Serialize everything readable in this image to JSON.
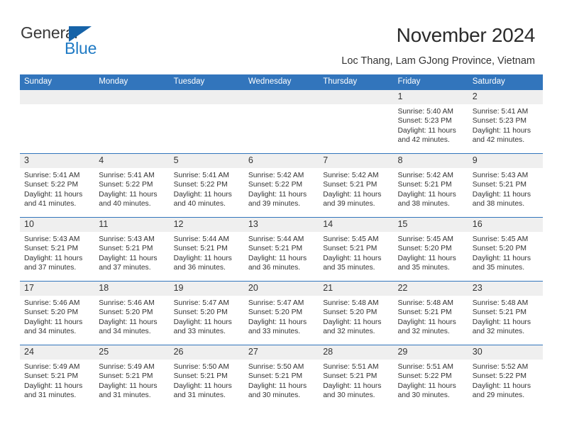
{
  "logo": {
    "word1": "General",
    "word2": "Blue",
    "triangle_color": "#1663a8",
    "blue_color": "#1f7ac4"
  },
  "header": {
    "title": "November 2024",
    "subtitle": "Loc Thang, Lam GJong Province, Vietnam",
    "header_bg": "#3275bc",
    "daynum_bg": "#efefef"
  },
  "weekdays": [
    "Sunday",
    "Monday",
    "Tuesday",
    "Wednesday",
    "Thursday",
    "Friday",
    "Saturday"
  ],
  "labels": {
    "sunrise": "Sunrise:",
    "sunset": "Sunset:",
    "daylight": "Daylight:"
  },
  "weeks": [
    [
      {
        "day": "",
        "empty": true
      },
      {
        "day": "",
        "empty": true
      },
      {
        "day": "",
        "empty": true
      },
      {
        "day": "",
        "empty": true
      },
      {
        "day": "",
        "empty": true
      },
      {
        "day": "1",
        "sunrise": "Sunrise: 5:40 AM",
        "sunset": "Sunset: 5:23 PM",
        "daylight1": "Daylight: 11 hours",
        "daylight2": "and 42 minutes."
      },
      {
        "day": "2",
        "sunrise": "Sunrise: 5:41 AM",
        "sunset": "Sunset: 5:23 PM",
        "daylight1": "Daylight: 11 hours",
        "daylight2": "and 42 minutes."
      }
    ],
    [
      {
        "day": "3",
        "sunrise": "Sunrise: 5:41 AM",
        "sunset": "Sunset: 5:22 PM",
        "daylight1": "Daylight: 11 hours",
        "daylight2": "and 41 minutes."
      },
      {
        "day": "4",
        "sunrise": "Sunrise: 5:41 AM",
        "sunset": "Sunset: 5:22 PM",
        "daylight1": "Daylight: 11 hours",
        "daylight2": "and 40 minutes."
      },
      {
        "day": "5",
        "sunrise": "Sunrise: 5:41 AM",
        "sunset": "Sunset: 5:22 PM",
        "daylight1": "Daylight: 11 hours",
        "daylight2": "and 40 minutes."
      },
      {
        "day": "6",
        "sunrise": "Sunrise: 5:42 AM",
        "sunset": "Sunset: 5:22 PM",
        "daylight1": "Daylight: 11 hours",
        "daylight2": "and 39 minutes."
      },
      {
        "day": "7",
        "sunrise": "Sunrise: 5:42 AM",
        "sunset": "Sunset: 5:21 PM",
        "daylight1": "Daylight: 11 hours",
        "daylight2": "and 39 minutes."
      },
      {
        "day": "8",
        "sunrise": "Sunrise: 5:42 AM",
        "sunset": "Sunset: 5:21 PM",
        "daylight1": "Daylight: 11 hours",
        "daylight2": "and 38 minutes."
      },
      {
        "day": "9",
        "sunrise": "Sunrise: 5:43 AM",
        "sunset": "Sunset: 5:21 PM",
        "daylight1": "Daylight: 11 hours",
        "daylight2": "and 38 minutes."
      }
    ],
    [
      {
        "day": "10",
        "sunrise": "Sunrise: 5:43 AM",
        "sunset": "Sunset: 5:21 PM",
        "daylight1": "Daylight: 11 hours",
        "daylight2": "and 37 minutes."
      },
      {
        "day": "11",
        "sunrise": "Sunrise: 5:43 AM",
        "sunset": "Sunset: 5:21 PM",
        "daylight1": "Daylight: 11 hours",
        "daylight2": "and 37 minutes."
      },
      {
        "day": "12",
        "sunrise": "Sunrise: 5:44 AM",
        "sunset": "Sunset: 5:21 PM",
        "daylight1": "Daylight: 11 hours",
        "daylight2": "and 36 minutes."
      },
      {
        "day": "13",
        "sunrise": "Sunrise: 5:44 AM",
        "sunset": "Sunset: 5:21 PM",
        "daylight1": "Daylight: 11 hours",
        "daylight2": "and 36 minutes."
      },
      {
        "day": "14",
        "sunrise": "Sunrise: 5:45 AM",
        "sunset": "Sunset: 5:21 PM",
        "daylight1": "Daylight: 11 hours",
        "daylight2": "and 35 minutes."
      },
      {
        "day": "15",
        "sunrise": "Sunrise: 5:45 AM",
        "sunset": "Sunset: 5:20 PM",
        "daylight1": "Daylight: 11 hours",
        "daylight2": "and 35 minutes."
      },
      {
        "day": "16",
        "sunrise": "Sunrise: 5:45 AM",
        "sunset": "Sunset: 5:20 PM",
        "daylight1": "Daylight: 11 hours",
        "daylight2": "and 35 minutes."
      }
    ],
    [
      {
        "day": "17",
        "sunrise": "Sunrise: 5:46 AM",
        "sunset": "Sunset: 5:20 PM",
        "daylight1": "Daylight: 11 hours",
        "daylight2": "and 34 minutes."
      },
      {
        "day": "18",
        "sunrise": "Sunrise: 5:46 AM",
        "sunset": "Sunset: 5:20 PM",
        "daylight1": "Daylight: 11 hours",
        "daylight2": "and 34 minutes."
      },
      {
        "day": "19",
        "sunrise": "Sunrise: 5:47 AM",
        "sunset": "Sunset: 5:20 PM",
        "daylight1": "Daylight: 11 hours",
        "daylight2": "and 33 minutes."
      },
      {
        "day": "20",
        "sunrise": "Sunrise: 5:47 AM",
        "sunset": "Sunset: 5:20 PM",
        "daylight1": "Daylight: 11 hours",
        "daylight2": "and 33 minutes."
      },
      {
        "day": "21",
        "sunrise": "Sunrise: 5:48 AM",
        "sunset": "Sunset: 5:20 PM",
        "daylight1": "Daylight: 11 hours",
        "daylight2": "and 32 minutes."
      },
      {
        "day": "22",
        "sunrise": "Sunrise: 5:48 AM",
        "sunset": "Sunset: 5:21 PM",
        "daylight1": "Daylight: 11 hours",
        "daylight2": "and 32 minutes."
      },
      {
        "day": "23",
        "sunrise": "Sunrise: 5:48 AM",
        "sunset": "Sunset: 5:21 PM",
        "daylight1": "Daylight: 11 hours",
        "daylight2": "and 32 minutes."
      }
    ],
    [
      {
        "day": "24",
        "sunrise": "Sunrise: 5:49 AM",
        "sunset": "Sunset: 5:21 PM",
        "daylight1": "Daylight: 11 hours",
        "daylight2": "and 31 minutes."
      },
      {
        "day": "25",
        "sunrise": "Sunrise: 5:49 AM",
        "sunset": "Sunset: 5:21 PM",
        "daylight1": "Daylight: 11 hours",
        "daylight2": "and 31 minutes."
      },
      {
        "day": "26",
        "sunrise": "Sunrise: 5:50 AM",
        "sunset": "Sunset: 5:21 PM",
        "daylight1": "Daylight: 11 hours",
        "daylight2": "and 31 minutes."
      },
      {
        "day": "27",
        "sunrise": "Sunrise: 5:50 AM",
        "sunset": "Sunset: 5:21 PM",
        "daylight1": "Daylight: 11 hours",
        "daylight2": "and 30 minutes."
      },
      {
        "day": "28",
        "sunrise": "Sunrise: 5:51 AM",
        "sunset": "Sunset: 5:21 PM",
        "daylight1": "Daylight: 11 hours",
        "daylight2": "and 30 minutes."
      },
      {
        "day": "29",
        "sunrise": "Sunrise: 5:51 AM",
        "sunset": "Sunset: 5:22 PM",
        "daylight1": "Daylight: 11 hours",
        "daylight2": "and 30 minutes."
      },
      {
        "day": "30",
        "sunrise": "Sunrise: 5:52 AM",
        "sunset": "Sunset: 5:22 PM",
        "daylight1": "Daylight: 11 hours",
        "daylight2": "and 29 minutes."
      }
    ]
  ]
}
